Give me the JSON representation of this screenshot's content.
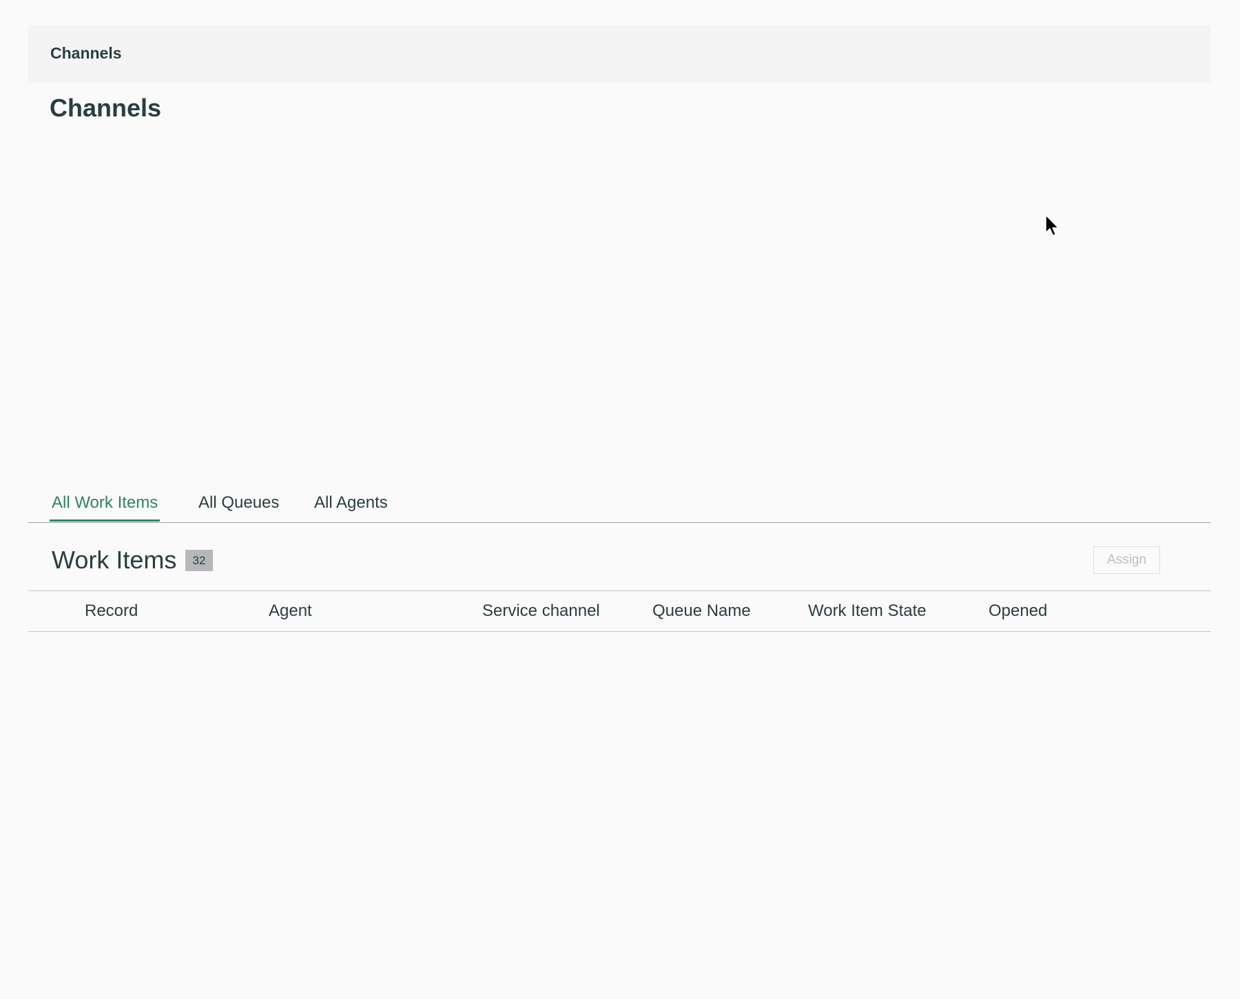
{
  "header": {
    "title": "Channels"
  },
  "page": {
    "title": "Channels"
  },
  "tabs": [
    {
      "label": "All Work Items",
      "active": true
    },
    {
      "label": "All Queues",
      "active": false
    },
    {
      "label": "All Agents",
      "active": false
    }
  ],
  "work_items": {
    "title": "Work Items",
    "count": "32",
    "assign_label": "Assign",
    "assign_disabled": true
  },
  "table": {
    "columns": [
      "Record",
      "Agent",
      "Service channel",
      "Queue Name",
      "Work Item State",
      "Opened"
    ],
    "rows": []
  },
  "colors": {
    "accent": "#2e8462",
    "text": "#293e40",
    "background": "#fafafa",
    "header_bg": "#f4f4f4",
    "badge_bg": "#b4b8b9"
  },
  "icons": {
    "cursor": "mouse-pointer-icon"
  }
}
